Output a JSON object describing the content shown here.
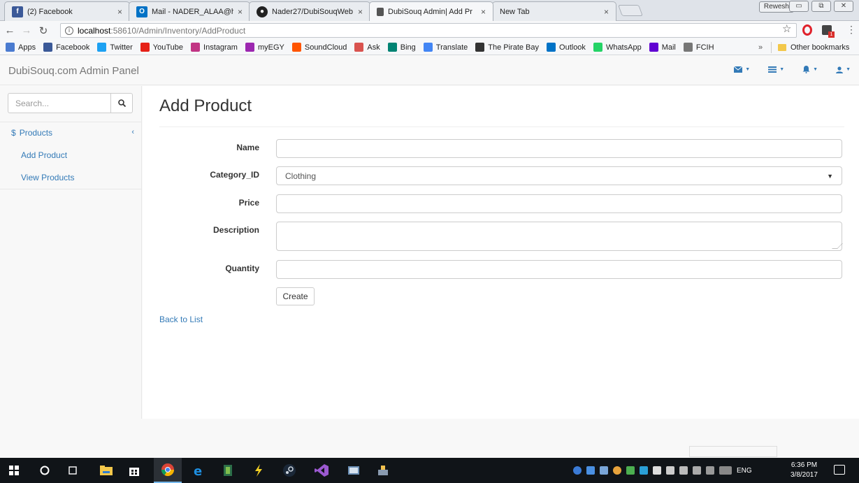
{
  "browser": {
    "tabs": [
      {
        "label": "(2) Facebook",
        "icon": "facebook-icon",
        "color": "#3b5998"
      },
      {
        "label": "Mail - NADER_ALAA@ho",
        "icon": "outlook-icon",
        "color": "#0072c6"
      },
      {
        "label": "Nader27/DubiSouqWeb",
        "icon": "github-icon",
        "color": "#222222"
      },
      {
        "label": "DubiSouq Admin| Add Pr",
        "icon": "page-icon",
        "color": "#555555"
      },
      {
        "label": "New Tab",
        "icon": "",
        "color": ""
      }
    ],
    "refresh_label": "Rewesh",
    "url_host": "localhost",
    "url_path": ":58610/Admin/Inventory/AddProduct",
    "bookmarks": [
      {
        "label": "Apps",
        "color": "#4a7bd0"
      },
      {
        "label": "Facebook",
        "color": "#3b5998"
      },
      {
        "label": "Twitter",
        "color": "#1da1f2"
      },
      {
        "label": "YouTube",
        "color": "#e62117"
      },
      {
        "label": "Instagram",
        "color": "#c13584"
      },
      {
        "label": "myEGY",
        "color": "#9c27b0"
      },
      {
        "label": "SoundCloud",
        "color": "#ff5500"
      },
      {
        "label": "Ask",
        "color": "#d9534f"
      },
      {
        "label": "Bing",
        "color": "#008373"
      },
      {
        "label": "Translate",
        "color": "#4285f4"
      },
      {
        "label": "The Pirate Bay",
        "color": "#333333"
      },
      {
        "label": "Outlook",
        "color": "#0072c6"
      },
      {
        "label": "WhatsApp",
        "color": "#25d366"
      },
      {
        "label": "Mail",
        "color": "#6001d2"
      },
      {
        "label": "FCIH",
        "color": "#777777"
      }
    ],
    "bookmarks_more": "»",
    "other_bookmarks": "Other bookmarks"
  },
  "navbar": {
    "brand": "DubiSouq.com Admin Panel",
    "icons": [
      "envelope-icon",
      "tasks-icon",
      "bell-icon",
      "user-icon"
    ]
  },
  "sidebar": {
    "search_placeholder": "Search...",
    "products_label": "Products",
    "products_prefix": "$",
    "add_product_label": "Add Product",
    "view_products_label": "View Products"
  },
  "main": {
    "title": "Add Product",
    "fields": {
      "name_label": "Name",
      "name_value": "",
      "category_label": "Category_ID",
      "category_value": "Clothing",
      "price_label": "Price",
      "price_value": "",
      "description_label": "Description",
      "description_value": "",
      "quantity_label": "Quantity",
      "quantity_value": ""
    },
    "create_label": "Create",
    "back_label": "Back to List"
  },
  "taskbar": {
    "language": "ENG",
    "time": "6:36 PM",
    "date": "3/8/2017"
  },
  "colors": {
    "link": "#337ab7",
    "taskbar": "#101418"
  }
}
